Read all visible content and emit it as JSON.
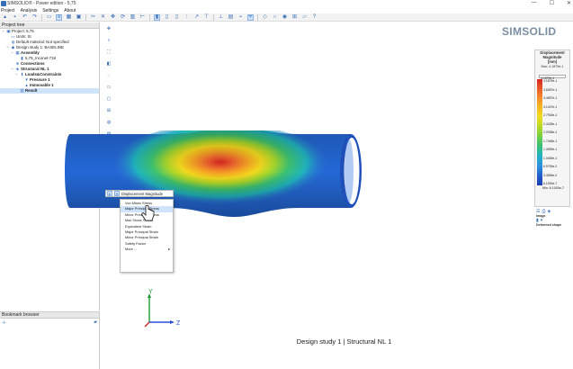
{
  "titlebar": {
    "title": "SIMSOLID® - Power edition - 5,75",
    "ctrls": [
      "—",
      "☐",
      "✕"
    ]
  },
  "menubar": {
    "items": [
      "Project",
      "Analysis",
      "Settings",
      "About"
    ]
  },
  "toolbar": {
    "icons": [
      "open-icon",
      "save-icon",
      "undo-icon",
      "redo-icon",
      "view-icon",
      "layout-icon",
      "grid-icon",
      "box-icon",
      "scissors-icon",
      "cross-icon",
      "move-icon",
      "rotate-icon",
      "chart-icon",
      "ruler-icon",
      "select-icon",
      "part-icon",
      "assembly-icon",
      "connect-icon",
      "arrow-icon",
      "bolt-icon",
      "split-icon",
      "bar-icon",
      "graph-icon",
      "measure-icon",
      "probe-icon",
      "magnet-icon",
      "eye-icon",
      "mesh-icon",
      "tag-icon",
      "help-icon"
    ]
  },
  "project_tree": {
    "header": "Project tree",
    "items": [
      {
        "label": "Project: 5,75",
        "depth": 0,
        "icon": "project-icon",
        "expand": "−"
      },
      {
        "label": "Units: SI",
        "depth": 1,
        "icon": "units-icon",
        "expand": ""
      },
      {
        "label": "Default material: Not specified",
        "depth": 1,
        "icon": "material-icon",
        "expand": ""
      },
      {
        "label": "Design study 1: BASELINE",
        "depth": 1,
        "icon": "study-icon",
        "expand": "−"
      },
      {
        "label": "Assembly",
        "depth": 2,
        "icon": "assembly-icon",
        "expand": "−"
      },
      {
        "label": "5,75_Inconel-718",
        "depth": 3,
        "icon": "part-icon",
        "expand": ""
      },
      {
        "label": "Connections",
        "depth": 2,
        "icon": "connections-icon",
        "expand": ""
      },
      {
        "label": "Structural NL 1",
        "depth": 2,
        "icon": "analysis-icon",
        "expand": "−"
      },
      {
        "label": "Loads&Constraints",
        "depth": 3,
        "icon": "loads-icon",
        "expand": "−"
      },
      {
        "label": "Pressure 1",
        "depth": 4,
        "icon": "pressure-icon",
        "expand": ""
      },
      {
        "label": "Immovable 1",
        "depth": 4,
        "icon": "immovable-icon",
        "expand": ""
      },
      {
        "label": "Result",
        "depth": 3,
        "icon": "result-icon",
        "expand": "",
        "selected": true
      }
    ]
  },
  "bookmarks": {
    "header": "Bookmark browser"
  },
  "left_tools": [
    "pan-icon",
    "zoom-icon",
    "fit-icon",
    "section-icon",
    "transparent-icon",
    "display-icon",
    "edges-icon",
    "wireframe-icon",
    "color-icon",
    "fringe-icon",
    "animate-icon",
    "probe-icon",
    "list-icon",
    "export-icon",
    "plot-icon",
    "link-icon"
  ],
  "logo": {
    "text": "SIMSOLID"
  },
  "legend": {
    "title": "Displacement Magnitude",
    "unit": "[mm]",
    "max": "Max: 4.1879e-1",
    "max_field": "4.1879e-1",
    "values": [
      "4.1879e-1",
      "3.8387e-1",
      "3.4897e-1",
      "3.1407e-1",
      "2.7918e-1",
      "2.4428e-1",
      "2.0938e-1",
      "1.7448e-1",
      "1.3959e-1",
      "1.0469e-1",
      "6.9793e-2",
      "3.4896e-2",
      "6.1000e-7"
    ],
    "min": "Min: 6.1000e-7",
    "colors": [
      "#d7261f",
      "#ef6b2e",
      "#f5a623",
      "#f4d81e",
      "#c9dd22",
      "#7fd13a",
      "#3cc271",
      "#20b4c0",
      "#2d8fe0",
      "#2058c8",
      "#1f3fb0"
    ]
  },
  "right_panel": {
    "image_label": "Image",
    "deformed_label": "Deformed shape"
  },
  "context": {
    "header": "Displacement Magnitude",
    "items": [
      {
        "label": "Von Mises Stress"
      },
      {
        "label": "Major Principal Stress",
        "highlighted": true
      },
      {
        "label": "Minor Principal Stress"
      },
      {
        "label": "Max Shear Stress"
      },
      {
        "label": "Equivalent Strain"
      },
      {
        "label": "Major Principal Strain"
      },
      {
        "label": "Minor Principal Strain"
      },
      {
        "label": "Safety Factor"
      },
      {
        "label": "More ...",
        "has_submenu": true
      }
    ]
  },
  "axis": {
    "y": "Y",
    "z": "Z"
  },
  "status": "Design study 1 | Structural NL 1"
}
